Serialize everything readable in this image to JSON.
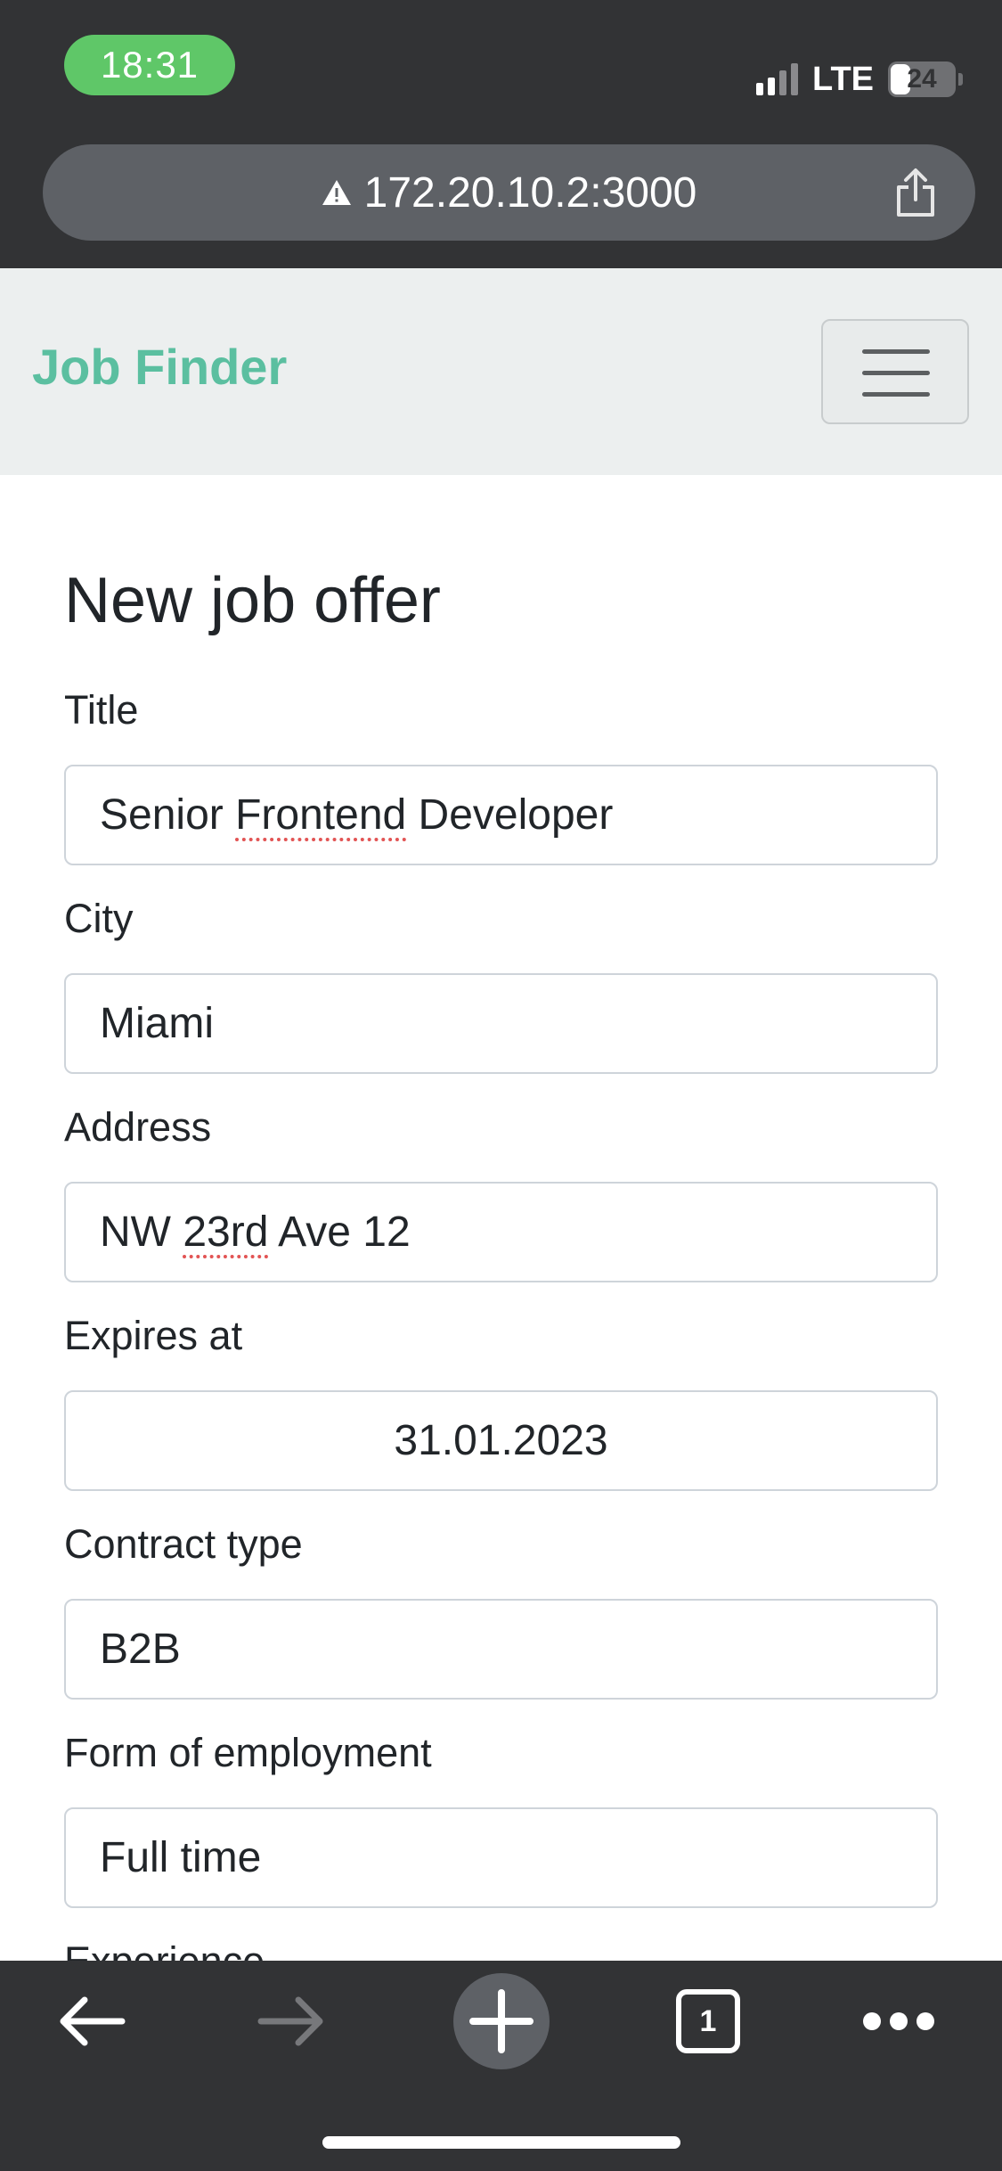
{
  "status_bar": {
    "time": "18:31",
    "network": "LTE",
    "battery": "24"
  },
  "browser": {
    "url": "172.20.10.2:3000",
    "warning_icon": "warning-triangle-icon",
    "share_icon": "share-icon",
    "tab_count": "1"
  },
  "navbar": {
    "brand": "Job Finder",
    "toggler_icon": "hamburger-icon"
  },
  "form": {
    "heading": "New job offer",
    "title_label": "Title",
    "title_value": "Senior Frontend Developer",
    "title_value_parts": [
      "Senior ",
      "Frontend",
      " Developer"
    ],
    "city_label": "City",
    "city_value": "Miami",
    "address_label": "Address",
    "address_value_parts": [
      "NW ",
      "23rd",
      " Ave 12"
    ],
    "expires_label": "Expires at",
    "expires_value": "31.01.2023",
    "contract_label": "Contract type",
    "contract_value": "B2B",
    "employment_label": "Form of employment",
    "employment_value": "Full time",
    "experience_label": "Experience"
  },
  "colors": {
    "brand": "#5bbfa0",
    "chrome": "#323335",
    "time_pill": "#5fc768",
    "navbar_bg": "#ecefef"
  }
}
